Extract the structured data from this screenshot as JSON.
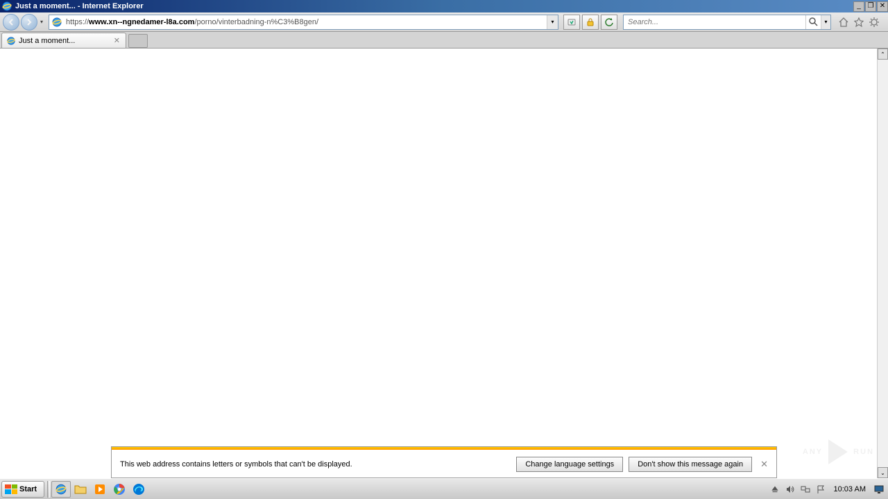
{
  "titlebar": {
    "text": "Just a moment... - Internet Explorer"
  },
  "url": {
    "scheme": "https://",
    "host": "www.xn--ngnedamer-l8a.com",
    "path": "/porno/vinterbadning-n%C3%B8gen/"
  },
  "search": {
    "placeholder": "Search..."
  },
  "tab": {
    "title": "Just a moment..."
  },
  "notif": {
    "text": "This web address contains letters or symbols that can't be displayed.",
    "btn_change": "Change language settings",
    "btn_dismiss": "Don't show this message again"
  },
  "taskbar": {
    "start": "Start",
    "clock": "10:03 AM"
  },
  "watermark": {
    "left": "ANY",
    "right": "RUN"
  }
}
